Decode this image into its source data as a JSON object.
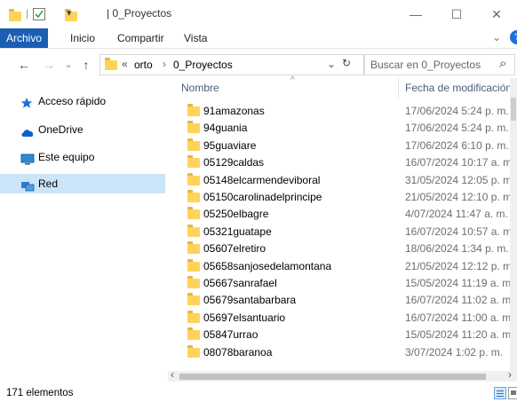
{
  "window": {
    "title": "| 0_Proyectos",
    "qa_sep": "|",
    "qa_dropdown": "▾",
    "minimize": "—",
    "maximize": "☐",
    "close": "✕"
  },
  "ribbon": {
    "tabs": [
      "Archivo",
      "Inicio",
      "Compartir",
      "Vista"
    ],
    "expand_icon": "⌄",
    "help_icon": "?"
  },
  "nav": {
    "back": "←",
    "forward": "→",
    "recent": "⌄",
    "up": "↑",
    "address_prefix": "«",
    "address_parts": [
      "orto",
      "›",
      "0_Proyectos"
    ],
    "address_dropdown": "⌄",
    "refresh": "↻",
    "search_placeholder": "Buscar en 0_Proyectos",
    "search_icon": "⌕"
  },
  "sidebar": {
    "items": [
      {
        "label": "Acceso rápido",
        "icon": "star-icon",
        "color": "#1e6fd9"
      },
      {
        "label": "OneDrive",
        "icon": "cloud-icon",
        "color": "#0a64c9"
      },
      {
        "label": "Este equipo",
        "icon": "computer-icon",
        "color": "#2b8ad8"
      },
      {
        "label": "Red",
        "icon": "network-icon",
        "color": "#2f7bd6"
      }
    ]
  },
  "list": {
    "columns": {
      "name": "Nombre",
      "date": "Fecha de modificación",
      "sort_indicator": "^"
    },
    "rows": [
      {
        "name": "91amazonas",
        "date": "17/06/2024 5:24 p. m."
      },
      {
        "name": "94guania",
        "date": "17/06/2024 5:24 p. m."
      },
      {
        "name": "95guaviare",
        "date": "17/06/2024 6:10 p. m."
      },
      {
        "name": "05129caldas",
        "date": "16/07/2024 10:17 a. m."
      },
      {
        "name": "05148elcarmendeviboral",
        "date": "31/05/2024 12:05 p. m."
      },
      {
        "name": "05150carolinadelprincipe",
        "date": "21/05/2024 12:10 p. m."
      },
      {
        "name": "05250elbagre",
        "date": "4/07/2024 11:47 a. m."
      },
      {
        "name": "05321guatape",
        "date": "16/07/2024 10:57 a. m."
      },
      {
        "name": "05607elretiro",
        "date": "18/06/2024 1:34 p. m."
      },
      {
        "name": "05658sanjosedelamontana",
        "date": "21/05/2024 12:12 p. m."
      },
      {
        "name": "05667sanrafael",
        "date": "15/05/2024 11:19 a. m."
      },
      {
        "name": "05679santabarbara",
        "date": "16/07/2024 11:02 a. m."
      },
      {
        "name": "05697elsantuario",
        "date": "16/07/2024 11:00 a. m."
      },
      {
        "name": "05847urrao",
        "date": "15/05/2024 11:20 a. m."
      },
      {
        "name": "08078baranoa",
        "date": "3/07/2024 1:02 p. m."
      }
    ],
    "scroll_left": "‹",
    "scroll_right": "›"
  },
  "status": {
    "count_text": "171 elementos"
  },
  "colors": {
    "folder": "#ffd35a",
    "accent": "#1a5fb4",
    "selection": "#cce4f7"
  }
}
